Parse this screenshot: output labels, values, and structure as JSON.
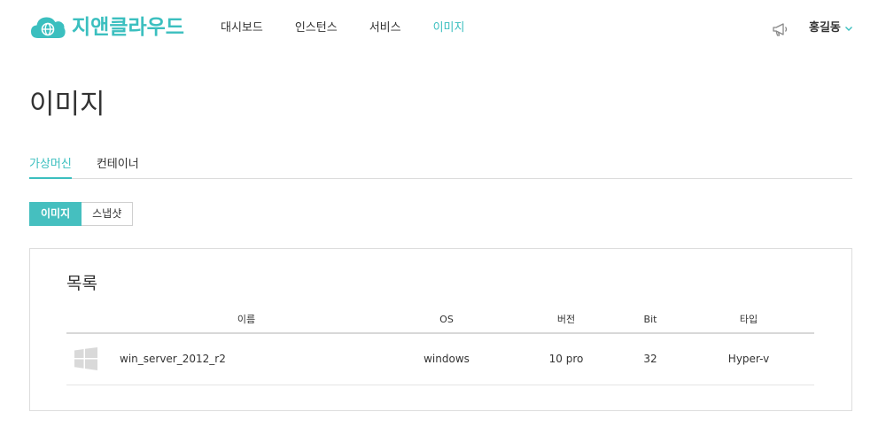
{
  "app": {
    "brand": "지앤클라우드",
    "accent_color": "#3bbfbf"
  },
  "header": {
    "nav": [
      {
        "label": "대시보드",
        "active": false
      },
      {
        "label": "인스턴스",
        "active": false
      },
      {
        "label": "서비스",
        "active": false
      },
      {
        "label": "이미지",
        "active": true
      }
    ],
    "notification_icon": "megaphone-icon",
    "user_name": "홍길동"
  },
  "page": {
    "title": "이미지"
  },
  "tabs": [
    {
      "label": "가상머신",
      "active": true
    },
    {
      "label": "컨테이너",
      "active": false
    }
  ],
  "segmented": [
    {
      "label": "이미지",
      "active": true
    },
    {
      "label": "스냅샷",
      "active": false
    }
  ],
  "list": {
    "title": "목록",
    "columns": [
      "이름",
      "OS",
      "버전",
      "Bit",
      "타입"
    ],
    "rows": [
      {
        "icon": "windows-icon",
        "name": "win_server_2012_r2",
        "os": "windows",
        "version": "10 pro",
        "bit": "32",
        "type": "Hyper-v"
      }
    ]
  }
}
